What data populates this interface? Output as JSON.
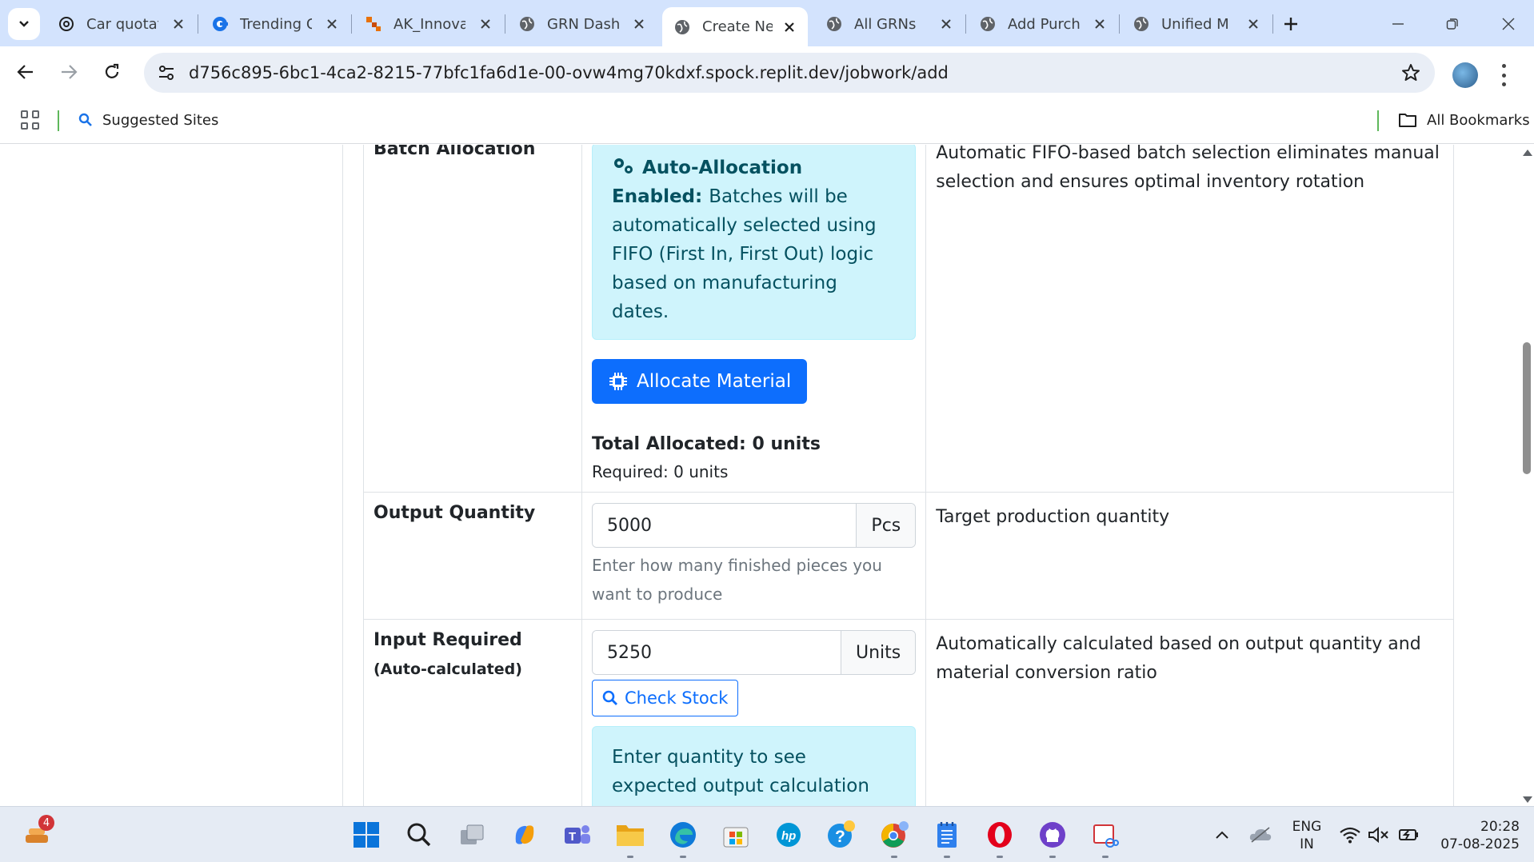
{
  "browser": {
    "tabs": [
      {
        "title": "Car quotat",
        "active": false
      },
      {
        "title": "Trending C",
        "active": false
      },
      {
        "title": "AK_Innova",
        "active": false
      },
      {
        "title": "GRN Dashb",
        "active": false
      },
      {
        "title": "Create Nev",
        "active": true
      },
      {
        "title": "All GRNs",
        "active": false
      },
      {
        "title": "Add Purch",
        "active": false
      },
      {
        "title": "Unified M",
        "active": false
      }
    ],
    "url": "d756c895-6bc1-4ca2-8215-77bfc1fa6d1e-00-ovw4mg70kdxf.spock.replit.dev/jobwork/add",
    "bookmarks": {
      "suggested": "Suggested Sites",
      "all": "All Bookmarks"
    }
  },
  "page": {
    "batch_row": {
      "label": "Batch Allocation",
      "alert_title": "Auto-Allocation Enabled:",
      "alert_body": "Batches will be automatically selected using FIFO (First In, First Out) logic based on manufacturing dates.",
      "allocate_button": "Allocate Material",
      "total_allocated": "Total Allocated: 0 units",
      "required": "Required: 0 units",
      "description": "Automatic FIFO-based batch selection eliminates manual selection and ensures optimal inventory rotation"
    },
    "output_row": {
      "label": "Output Quantity",
      "value": "5000",
      "unit": "Pcs",
      "help": "Enter how many finished pieces you want to produce",
      "description": "Target production quantity"
    },
    "input_row": {
      "label": "Input Required",
      "label_suffix": "(Auto-calculated)",
      "value": "5250",
      "unit": "Units",
      "check_button": "Check Stock",
      "alert": "Enter quantity to see expected output calculation",
      "description": "Automatically calculated based on output quantity and material conversion ratio"
    }
  },
  "taskbar": {
    "badge_count": "4",
    "lang_line1": "ENG",
    "lang_line2": "IN",
    "time": "20:28",
    "date": "07-08-2025"
  },
  "colors": {
    "primary": "#0d6efd",
    "info_bg": "#cff4fc",
    "info_text": "#055160",
    "tabstrip": "#d3e3fd"
  }
}
